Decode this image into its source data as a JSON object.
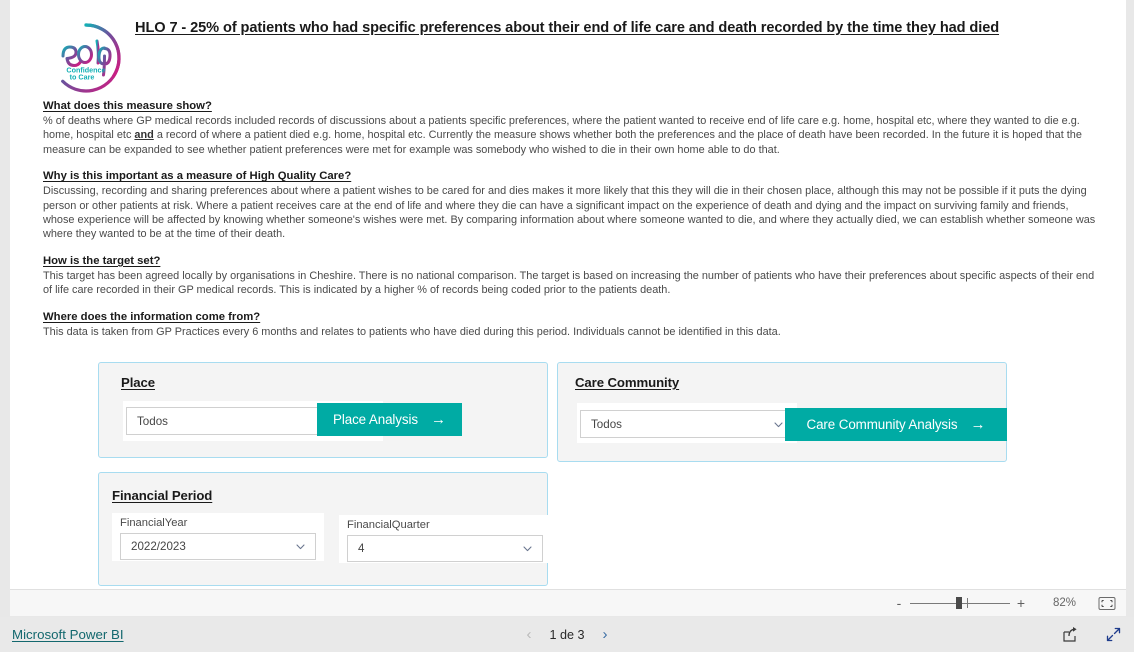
{
  "report": {
    "title": "HLO 7 - 25% of patients who had specific preferences about their end of life care and death recorded by the time they had died",
    "logo": {
      "mark": "eolp",
      "tagline_line1": "Confidence",
      "tagline_line2": "to Care"
    }
  },
  "sections": [
    {
      "heading": "What does this measure show?",
      "body_part1": "% of deaths where GP medical records included records of discussions about a patients specific preferences, where the patient wanted to receive end of life care e.g. home, hospital etc, where they wanted to die e.g. home, hospital etc ",
      "body_emphasis": "and",
      "body_part2": " a record of where a patient died e.g. home, hospital etc. Currently the measure shows whether both the preferences and the place of death have been recorded. In the future it is hoped that the measure can be expanded to see whether patient preferences were met for example was somebody who wished to die in their own home able to do that."
    },
    {
      "heading": "Why is this important as a measure of High Quality Care?",
      "body_part1": "Discussing, recording and sharing preferences about where a patient wishes to be cared for and dies makes it more likely that this they will die in their chosen place, although this may not be possible if it puts the dying person or other patients at risk. Where a patient receives care at the end of life and where they die can have a significant impact on the experience of death and dying and the impact on surviving family and friends, whose experience will be affected by knowing whether someone's wishes were met. By comparing information about where someone wanted to die, and where they actually died, we can establish whether someone was where they wanted to be at the time of their death.",
      "body_emphasis": "",
      "body_part2": ""
    },
    {
      "heading": "How is the target set?",
      "body_part1": "This target has been agreed locally by organisations in Cheshire. There is no national comparison. The target is based on increasing the number of patients who have their preferences about specific aspects of their end of life care recorded in their GP medical records. This is indicated by a higher % of records being coded prior to the patients death.",
      "body_emphasis": "",
      "body_part2": ""
    },
    {
      "heading": "Where does the information come from?",
      "body_part1": "This data is taken from GP Practices every 6 months and relates to patients who have died during this period. Individuals cannot be identified in this data.",
      "body_emphasis": "",
      "body_part2": ""
    }
  ],
  "cards": {
    "place": {
      "title": "Place",
      "slicer_value": "Todos",
      "button_label": "Place Analysis",
      "button_arrow": "→",
      "chevron_icon": "chevron-down-icon"
    },
    "care_community": {
      "title": "Care Community",
      "slicer_value": "Todos",
      "button_label": "Care Community Analysis",
      "button_arrow": "→",
      "chevron_icon": "chevron-down-icon"
    },
    "financial_period": {
      "title": "Financial Period",
      "year_caption": "FinancialYear",
      "year_value": "2022/2023",
      "quarter_caption": "FinancialQuarter",
      "quarter_value": "4",
      "chevron_icon": "chevron-down-icon"
    }
  },
  "statusbar": {
    "zoom_out_label": "-",
    "zoom_in_label": "+",
    "zoom_level": "82%",
    "fit_icon": "fit-to-page-icon"
  },
  "appbar": {
    "brand_label": "Microsoft Power BI",
    "prev_label": "‹",
    "page_label": "1 de 3",
    "next_label": "›",
    "share_icon": "share-icon",
    "fullscreen_icon": "fullscreen-icon"
  },
  "colors": {
    "teal_button": "#00aba4",
    "card_border": "#a8dcf0",
    "card_fill": "#f4f4f4",
    "brand_link": "#13686e"
  }
}
